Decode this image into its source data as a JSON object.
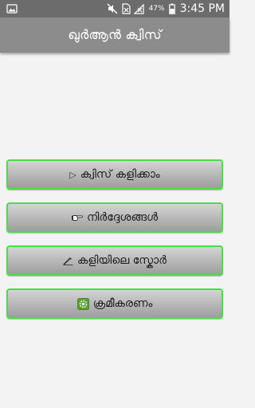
{
  "status_bar": {
    "battery_percent": "47%",
    "time": "3:45 PM"
  },
  "app_bar": {
    "title": "ഖുർആൻ ക്വിസ്"
  },
  "menu": {
    "items": [
      {
        "label": "ക്വിസ് കളിക്കാം",
        "icon": "play-icon"
      },
      {
        "label": "നിർദ്ദേശങ്ങൾ",
        "icon": "pointing-hand-icon"
      },
      {
        "label": "കളിയിലെ സ്കോർ",
        "icon": "pencil-icon"
      },
      {
        "label": "ക്രമീകരണം",
        "icon": "settings-icon"
      }
    ]
  },
  "colors": {
    "status_bar": "#6c6c6c",
    "app_bar": "#8c8c8c",
    "button_border": "#44e044",
    "background": "#f3f3f3"
  }
}
